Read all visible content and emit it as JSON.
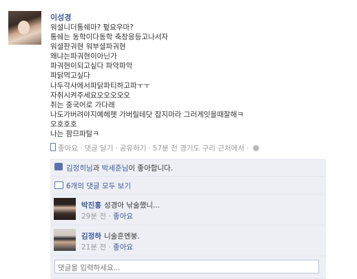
{
  "post": {
    "author": "이성경",
    "lines": [
      "워셜니더통쉐마? 펖요우마?",
      "통쉐는 동학이다동학 축창응등고나서자",
      "워셜판궈현 워부셜파궈현",
      "왜냐는파궈현이아닌가",
      "파궈현이되고싶다 파악파악",
      "파닭먹고싶다",
      "나두각사에서파닭파티하고파ㅜㅜ",
      "자취시켜주세요오오오오오",
      "취는 중국어로 가다래",
      "나도가버려야지예헤헷 가버릴테닷 잡지마라 그러게잇을때잘해ㅋ",
      "오호호호",
      "나는 팜므파탈ㅋ"
    ],
    "meta": {
      "like": "좋아요",
      "comment": "댓글 달기",
      "share": "공유하기",
      "time_location": "57분 전 경기도 구리 근처에서",
      "sep": "·"
    }
  },
  "likes": {
    "name1": "김정히님",
    "mid": "과 ",
    "name2": "박세준님",
    "suffix": "이 좋아합니다."
  },
  "view_all": "6개의 댓글 모두 보기",
  "comments": [
    {
      "name": "박진홍",
      "text": "성경아 낚술했니...",
      "time": "29분 전",
      "like": "좋아요"
    },
    {
      "name": "김정하",
      "text": "니술흔멘붕.",
      "time": "21분 전",
      "like": "좋아요"
    }
  ],
  "comment_input": {
    "placeholder": "댓글을 입력하세요..."
  }
}
